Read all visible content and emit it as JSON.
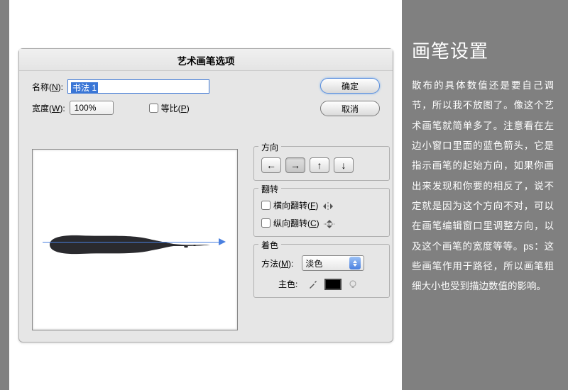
{
  "sidebar": {
    "title": "画笔设置",
    "body": "散布的具体数值还是要自己调节，所以我不放图了。像这个艺术画笔就简单多了。注意看在左边小窗口里面的蓝色箭头，它是指示画笔的起始方向，如果你画出来发现和你要的相反了，说不定就是因为这个方向不对，可以在画笔编辑窗口里调整方向，以及这个画笔的宽度等等。ps：这些画笔作用于路径，所以画笔粗细大小也受到描边数值的影响。"
  },
  "dialog": {
    "title": "艺术画笔选项",
    "name_label_pre": "名称(",
    "name_label_key": "N",
    "name_label_post": "):",
    "name_value": "书法 1",
    "width_label_pre": "宽度(",
    "width_label_key": "W",
    "width_label_post": "):",
    "width_value": "100%",
    "prop_label_pre": "等比(",
    "prop_label_key": "P",
    "prop_label_post": ")",
    "ok": "确定",
    "cancel": "取消",
    "direction_title": "方向",
    "dir_left": "←",
    "dir_right": "→",
    "dir_up": "↑",
    "dir_down": "↓",
    "flip_title": "翻转",
    "flip_h_pre": "横向翻转(",
    "flip_h_key": "F",
    "flip_h_post": ")",
    "flip_v_pre": "纵向翻转(",
    "flip_v_key": "C",
    "flip_v_post": ")",
    "color_title": "着色",
    "method_label_pre": "方法(",
    "method_label_key": "M",
    "method_label_post": "):",
    "method_value": "淡色",
    "keycolor_label": "主色:"
  }
}
